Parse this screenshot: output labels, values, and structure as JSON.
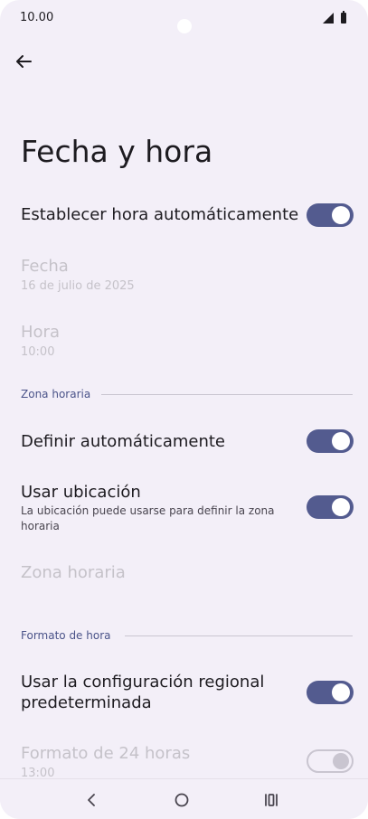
{
  "status_bar": {
    "time": "10.00"
  },
  "page_title": "Fecha y hora",
  "settings": {
    "auto_time": {
      "title": "Establecer hora automáticamente",
      "enabled": true
    },
    "date": {
      "title": "Fecha",
      "value": "16 de julio de 2025"
    },
    "time": {
      "title": "Hora",
      "value": "10:00"
    },
    "tz_section": "Zona horaria",
    "auto_tz": {
      "title": "Definir automáticamente",
      "enabled": true
    },
    "use_location": {
      "title": "Usar ubicación",
      "summary_line1": "La ubicación puede usarse para definir la zona",
      "summary_line2": "horaria",
      "enabled": true
    },
    "timezone": {
      "title": "Zona horaria"
    },
    "format_section": "Formato de hora",
    "locale_default": {
      "title_line1": "Usar la configuración regional",
      "title_line2": "predeterminada",
      "enabled": true
    },
    "format_24": {
      "title": "Formato de 24 horas",
      "value": "13:00",
      "enabled": true
    }
  },
  "colors": {
    "accent": "#535b8f",
    "background": "#f3eff8",
    "disabled_text": "#c5c2c9",
    "section": "#4a5389"
  },
  "icons": [
    "back-arrow-icon",
    "signal-icon",
    "battery-icon",
    "nav-back-icon",
    "nav-home-icon",
    "nav-recents-icon"
  ]
}
